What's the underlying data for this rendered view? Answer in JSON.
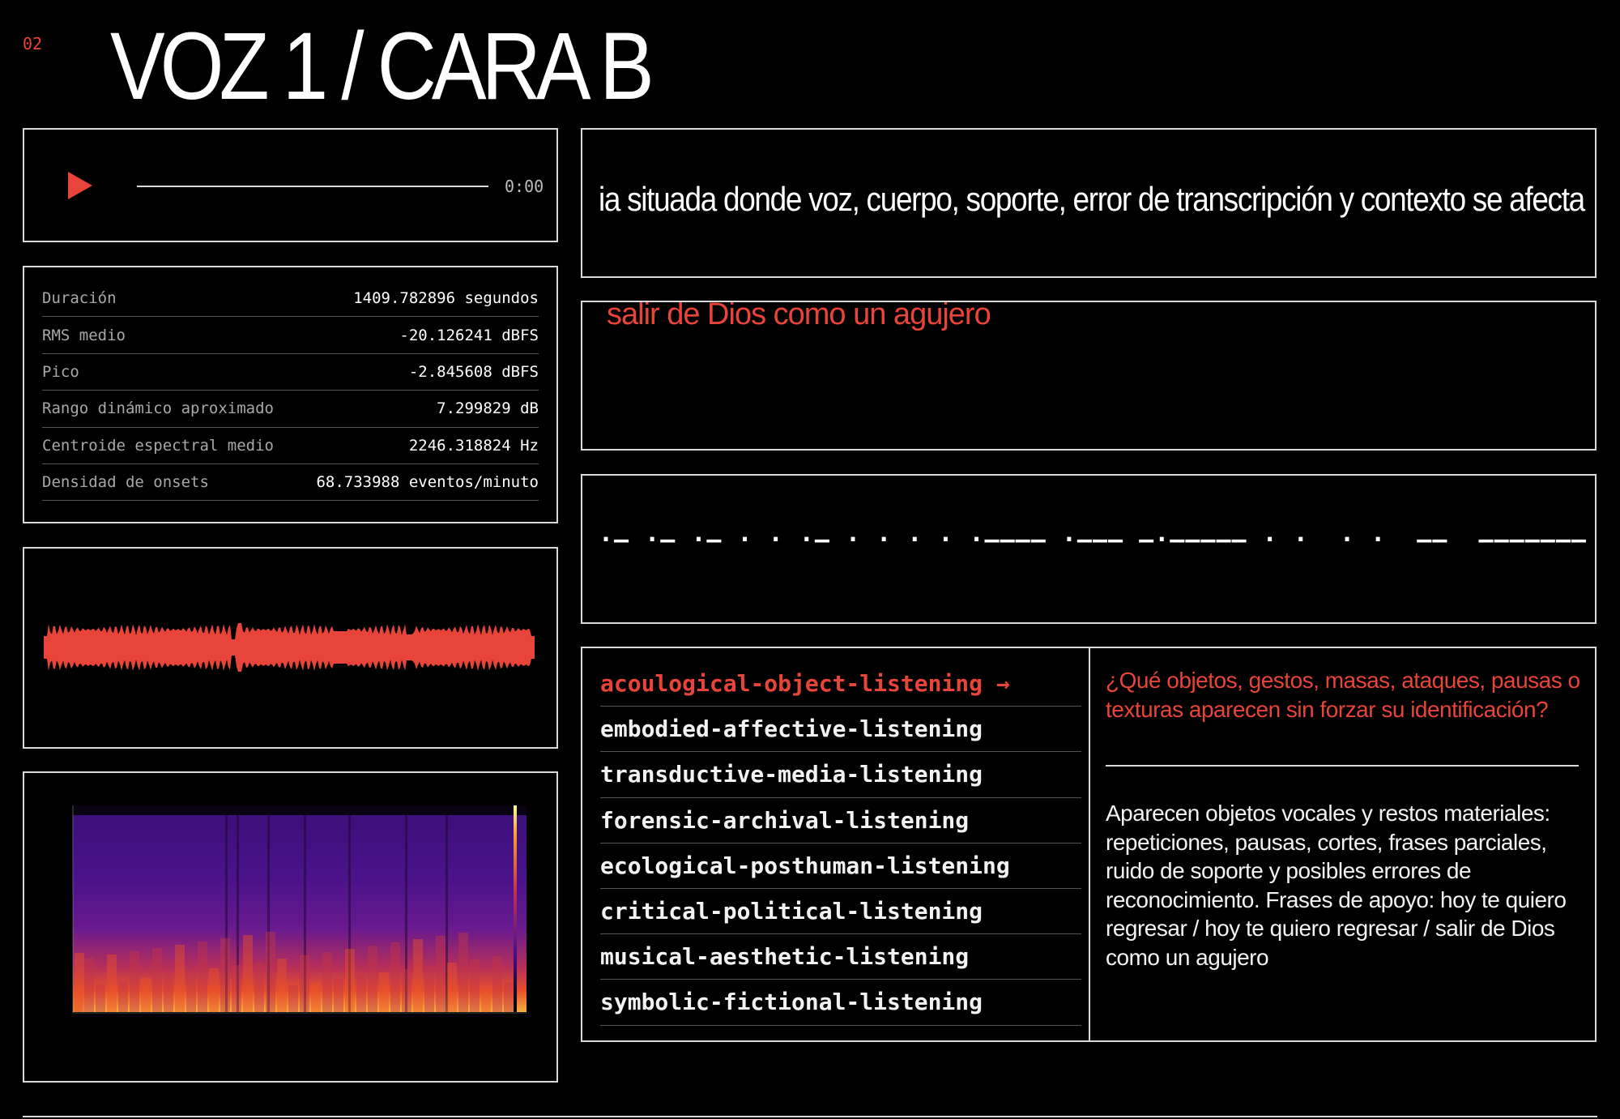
{
  "page_number": "02",
  "title": "VOZ 1 / CARA B",
  "player": {
    "time": "0:00",
    "progress": 0
  },
  "stats": [
    {
      "label": "Duración",
      "value": "1409.782896 segundos"
    },
    {
      "label": "RMS medio",
      "value": "-20.126241 dBFS"
    },
    {
      "label": "Pico",
      "value": "-2.845608 dBFS"
    },
    {
      "label": "Rango dinámico aproximado",
      "value": "7.299829 dB"
    },
    {
      "label": "Centroide espectral medio",
      "value": "2246.318824 Hz"
    },
    {
      "label": "Densidad de onsets",
      "value": "68.733988 eventos/minuto"
    }
  ],
  "colors": {
    "accent": "#e8443a",
    "border": "#d9d9d9",
    "background": "#000000"
  },
  "marquee_text": "ia situada donde voz, cuerpo, soporte, error de transcripción y contexto se afecta",
  "phrase_text": "salir de Dios como un agujero",
  "morse_text": "·— ·— ·— · · ·— · · · · ·———— ·——— —·————— · ·  · ·  ——  ——————— ·—",
  "modes": [
    {
      "label": "acoulogical-object-listening →",
      "active": true
    },
    {
      "label": "embodied-affective-listening",
      "active": false
    },
    {
      "label": "transductive-media-listening",
      "active": false
    },
    {
      "label": "forensic-archival-listening",
      "active": false
    },
    {
      "label": "ecological-posthuman-listening",
      "active": false
    },
    {
      "label": "critical-political-listening",
      "active": false
    },
    {
      "label": "musical-aesthetic-listening",
      "active": false
    },
    {
      "label": "symbolic-fictional-listening",
      "active": false
    }
  ],
  "question": "¿Qué objetos, gestos, masas, ataques, pausas o texturas aparecen sin forzar su identificación?",
  "answer": "Aparecen objetos vocales y restos materiales: repeticiones, pausas, cortes, frases parciales, ruido de soporte y posibles errores de reconocimiento. Frases de apoyo: hoy te quiero regresar / hoy te quiero regresar / salir de Dios como un agujero",
  "icons": {
    "play": "play-icon"
  }
}
